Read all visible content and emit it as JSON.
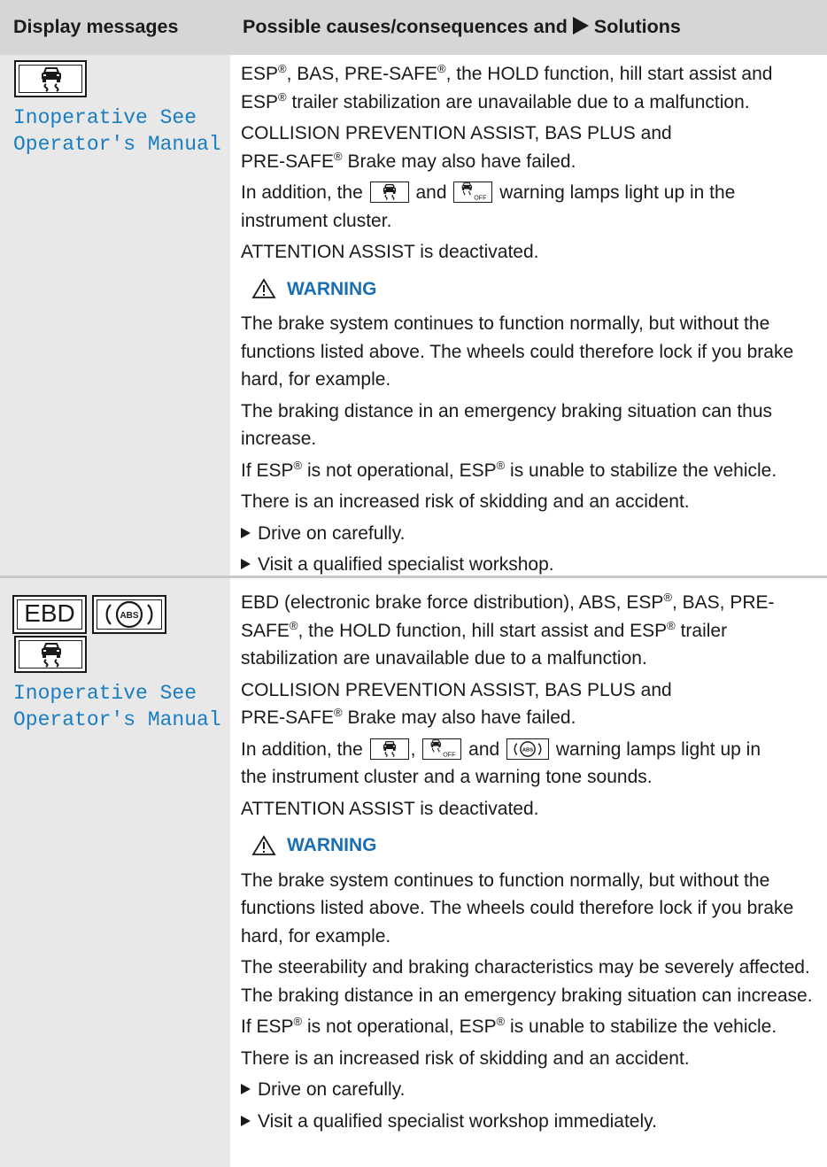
{
  "header": {
    "col1": "Display messages",
    "col2_before": "Possible causes/consequences and",
    "col2_after": "Solutions"
  },
  "rows": [
    {
      "display_icons": [
        "esp-skid-icon"
      ],
      "display_text_line1": "Inoperative See",
      "display_text_line2": "Operator's Manual",
      "p1_a": "ESP",
      "p1_b": ", BAS, PRE-SAFE",
      "p1_c": ", the HOLD function, hill start assist and",
      "p1_d": "ESP",
      "p1_e": " trailer stabilization are unavailable due to a malfunction.",
      "p2_line1": "COLLISION PREVENTION ASSIST, BAS PLUS and",
      "p2_a": "PRE-SAFE",
      "p2_b": " Brake may also have failed.",
      "p3_a": "In addition, the",
      "p3_b": "and",
      "p3_c": "warning lamps light up in the",
      "p3_d": "instrument cluster.",
      "p4": "ATTENTION ASSIST is deactivated.",
      "warning_label": "WARNING",
      "w1": "The brake system continues to function normally, but without the functions listed above. The wheels could therefore lock if you brake hard, for example.",
      "w2": "The braking distance in an emergency braking situation can thus increase.",
      "w3_a": "If ESP",
      "w3_b": " is not operational, ESP",
      "w3_c": " is unable to stabilize the vehicle.",
      "w4": "There is an increased risk of skidding and an accident.",
      "step1": "Drive on carefully.",
      "step2": "Visit a qualified specialist workshop."
    },
    {
      "display_icons": [
        "ebd-lamp",
        "abs-icon",
        "esp-skid-icon"
      ],
      "ebd_label": "EBD",
      "display_text_line1": "Inoperative See",
      "display_text_line2": "Operator's Manual",
      "p1_a": "EBD (electronic brake force distribution), ABS, ESP",
      "p1_b": ", BAS, PRE-",
      "p1_c": "SAFE",
      "p1_d": ", the HOLD function, hill start assist and ESP",
      "p1_e": " trailer",
      "p1_f": "stabilization are unavailable due to a malfunction.",
      "p2_line1": "COLLISION PREVENTION ASSIST, BAS PLUS and",
      "p2_a": "PRE-SAFE",
      "p2_b": " Brake may also have failed.",
      "p3_a": "In addition, the",
      "p3_b": ",",
      "p3_c": "and",
      "p3_d": "warning lamps light up in",
      "p3_e": "the instrument cluster and a warning tone sounds.",
      "p4": "ATTENTION ASSIST is deactivated.",
      "warning_label": "WARNING",
      "w1": "The brake system continues to function normally, but without the functions listed above. The wheels could therefore lock if you brake hard, for example.",
      "w2": "The steerability and braking characteristics may be severely affected. The braking distance in an emergency braking situation can increase.",
      "w3_a": "If ESP",
      "w3_b": " is not operational, ESP",
      "w3_c": " is unable to stabilize the vehicle.",
      "w4": "There is an increased risk of skidding and an accident.",
      "step1": "Drive on carefully.",
      "step2": "Visit a qualified specialist workshop immediately."
    }
  ],
  "symbols": {
    "registered": "®",
    "abs_text": "ABS",
    "off_text": "OFF"
  },
  "colors": {
    "display_text": "#1a7dc0",
    "warning": "#1a6fb4",
    "header_bg": "#d6d6d6",
    "left_col_bg": "#e8e8e8"
  }
}
